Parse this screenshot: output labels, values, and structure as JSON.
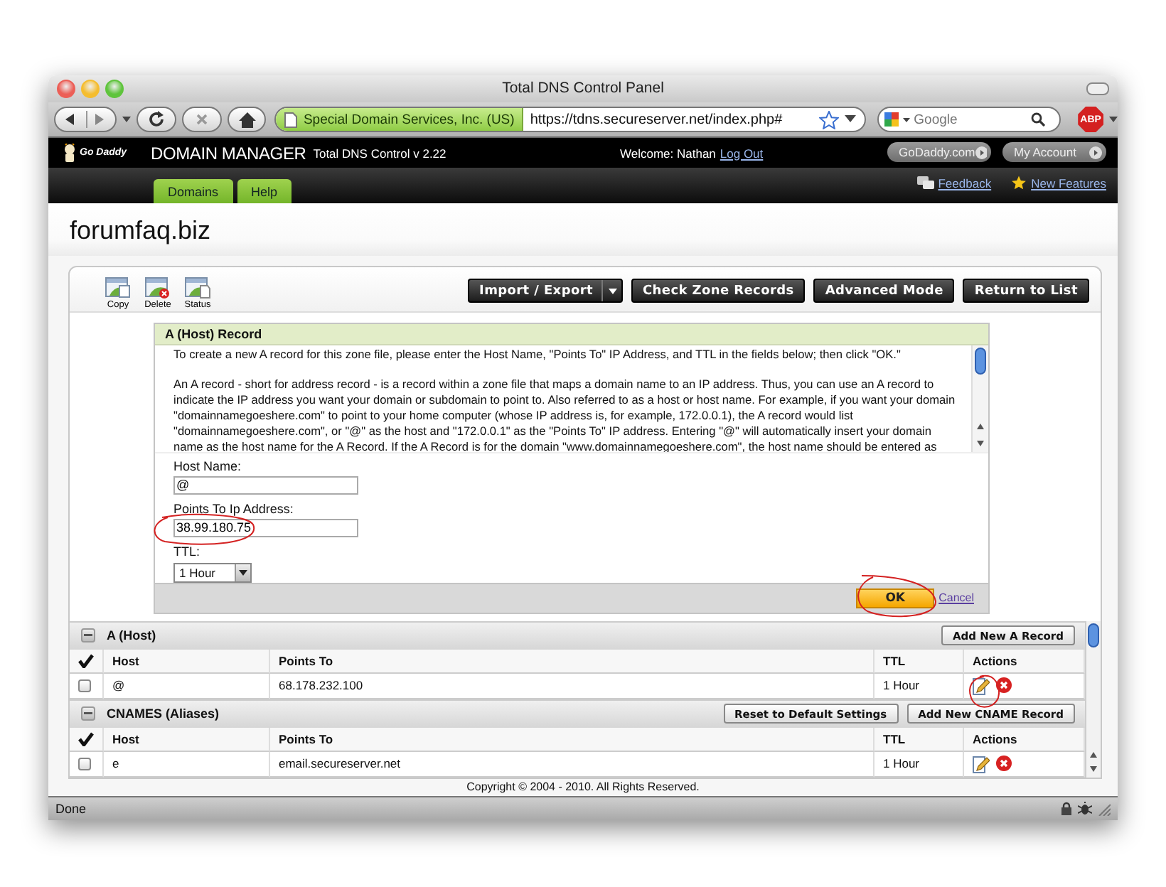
{
  "window": {
    "title": "Total DNS Control Panel"
  },
  "browser": {
    "identity": "Special Domain Services, Inc. (US)",
    "url": "https://tdns.secureserver.net/index.php#",
    "search": {
      "placeholder": "Google"
    },
    "adblock": "ABP"
  },
  "header": {
    "logo": "Go Daddy",
    "product": "DOMAIN MANAGER",
    "version": "Total DNS Control v 2.22",
    "welcome": "Welcome: Nathan",
    "logout": "Log Out",
    "buttons": [
      "GoDaddy.com",
      "My Account"
    ]
  },
  "tabs": [
    "Domains",
    "Help"
  ],
  "links": [
    {
      "label": "Feedback",
      "kind": "feedback"
    },
    {
      "label": "New Features",
      "kind": "star"
    }
  ],
  "domain": "forumfaq.biz",
  "tools": [
    {
      "label": "Copy",
      "kind": "copy"
    },
    {
      "label": "Delete",
      "kind": "delete"
    },
    {
      "label": "Status",
      "kind": "status"
    }
  ],
  "actions": [
    {
      "label": "Import / Export",
      "kind": "split"
    },
    {
      "label": "Check Zone Records",
      "kind": "plain"
    },
    {
      "label": "Advanced Mode",
      "kind": "plain"
    },
    {
      "label": "Return to List",
      "kind": "plain"
    }
  ],
  "dialog": {
    "title": "A (Host) Record",
    "paragraphs": [
      "To create a new A record for this zone file, please enter the Host Name, \"Points To\" IP Address, and TTL in the fields below; then click \"OK.\"",
      "An A record - short for address record - is a record within a zone file that maps a domain name to an IP address. Thus, you can use an A record to indicate the IP address you want your domain or subdomain to point to. Also referred to as a host or host name. For example, if you want your domain \"domainnamegoeshere.com\" to point to your home computer (whose IP address is, for example, 172.0.0.1), the A record would list \"domainnamegoeshere.com\", or \"@\" as the host and \"172.0.0.1\" as the \"Points To\" IP address. Entering \"@\" will automatically insert your domain name as the host name for the A Record. If the A Record is for the domain \"www.domainnamegoeshere.com\", the host name should be entered as"
    ],
    "fields": [
      {
        "label": "Host Name:",
        "value": "@"
      },
      {
        "label": "Points To Ip Address:",
        "value": "38.99.180.75"
      }
    ],
    "ttl": {
      "label": "TTL:",
      "value": "1 Hour"
    },
    "ok": "OK",
    "cancel": "Cancel"
  },
  "sections": [
    {
      "title": "A (Host)",
      "buttons": [
        "Add New A Record"
      ],
      "columns": [
        "Host",
        "Points To",
        "TTL",
        "Actions"
      ],
      "rows": [
        {
          "checked": false,
          "host": "@",
          "points_to": "68.178.232.100",
          "ttl": "1 Hour"
        }
      ]
    },
    {
      "title": "CNAMES (Aliases)",
      "buttons": [
        "Reset to Default Settings",
        "Add New CNAME Record"
      ],
      "columns": [
        "Host",
        "Points To",
        "TTL",
        "Actions"
      ],
      "rows": [
        {
          "checked": false,
          "host": "e",
          "points_to": "email.secureserver.net",
          "ttl": "1 Hour"
        }
      ]
    }
  ],
  "copyright": "Copyright © 2004 - 2010. All Rights Reserved.",
  "status_bar": {
    "text": "Done"
  }
}
